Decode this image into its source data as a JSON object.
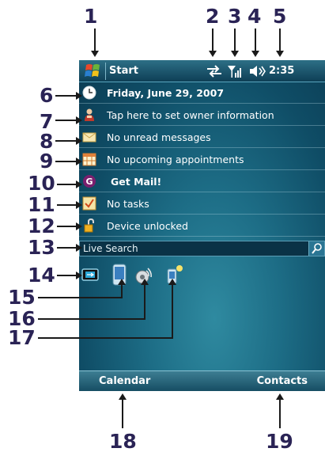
{
  "titlebar": {
    "start_label": "Start",
    "time": "2:35"
  },
  "today": {
    "date": "Friday, June 29, 2007",
    "owner": "Tap here to set owner information",
    "messages": "No unread messages",
    "appointments": "No upcoming appointments",
    "getmail": "Get Mail!",
    "tasks": "No tasks",
    "device": "Device unlocked"
  },
  "search": {
    "label": "Live Search"
  },
  "softkeys": {
    "left": "Calendar",
    "right": "Contacts"
  },
  "callouts": [
    "1",
    "2",
    "3",
    "4",
    "5",
    "6",
    "7",
    "8",
    "9",
    "10",
    "11",
    "12",
    "13",
    "14",
    "15",
    "16",
    "17",
    "18",
    "19"
  ],
  "icons": {
    "start": "windows-logo-icon",
    "connectivity": "sync-arrows-icon",
    "signal": "signal-strength-icon",
    "volume": "speaker-icon",
    "date": "clock-icon",
    "owner": "person-icon",
    "messages": "envelope-icon",
    "appointments": "calendar-icon",
    "getmail": "getmail-icon",
    "tasks": "task-check-icon",
    "device": "padlock-icon",
    "search": "magnifier-icon",
    "tray1": "comm-manager-icon",
    "tray2": "device-icon",
    "tray3": "wireless-icon",
    "tray4": "phone-light-icon"
  },
  "colors": {
    "callout": "#2a2355",
    "screen_dark": "#0b3b52",
    "screen_light": "#2f8aa0"
  }
}
